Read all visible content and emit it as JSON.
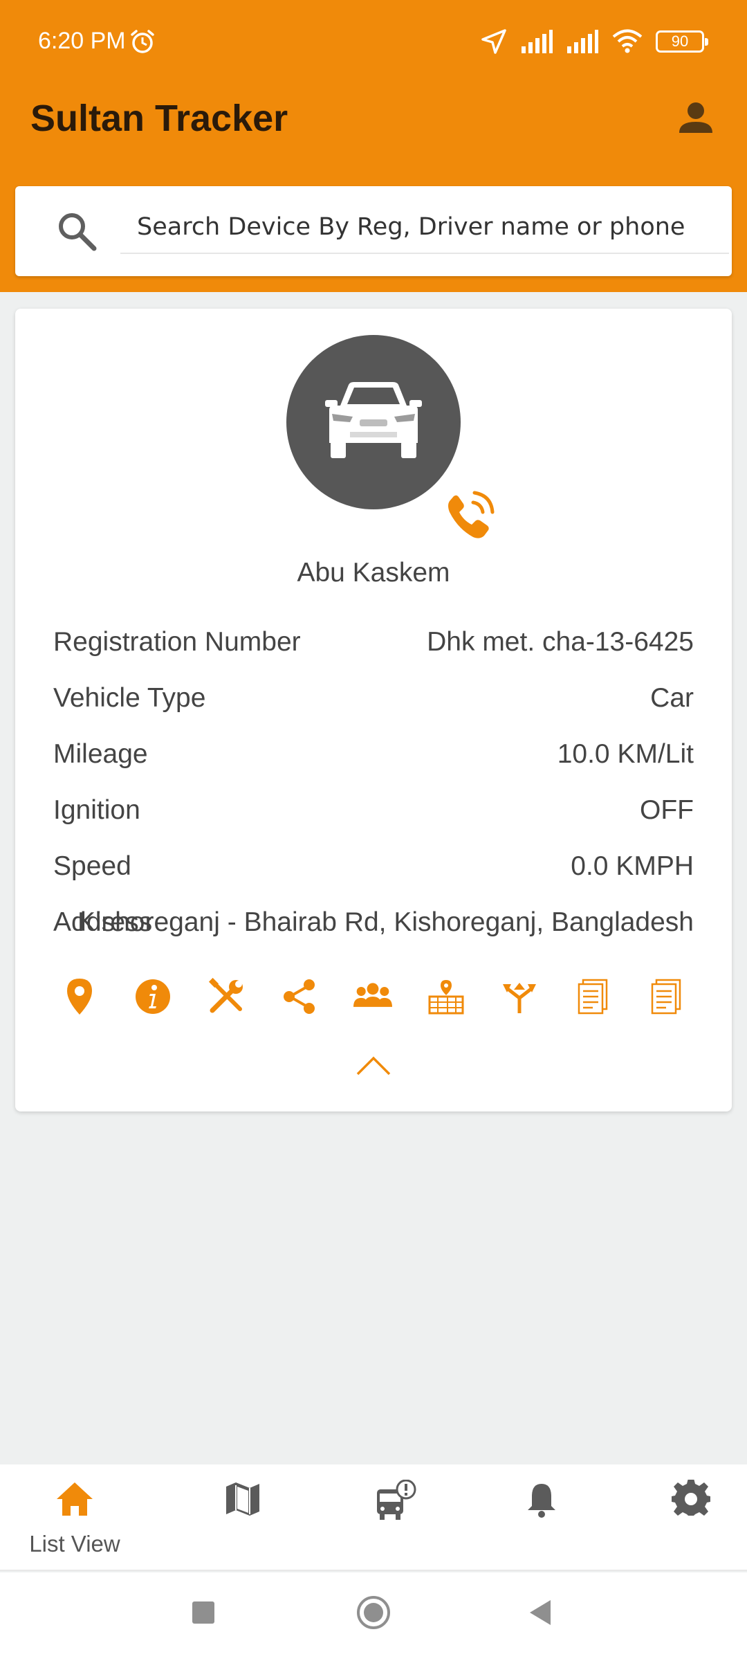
{
  "status_bar": {
    "time": "6:20 PM",
    "battery": "90"
  },
  "app": {
    "title": "Sultan Tracker"
  },
  "search": {
    "placeholder": "Search Device By Reg, Driver name or phone"
  },
  "vehicle": {
    "driver_name": "Abu Kaskem",
    "rows": [
      {
        "label": "Registration Number",
        "value": "Dhk met. cha-13-6425"
      },
      {
        "label": "Vehicle Type",
        "value": "Car"
      },
      {
        "label": "Mileage",
        "value": "10.0 KM/Lit"
      },
      {
        "label": "Ignition",
        "value": "OFF"
      },
      {
        "label": "Speed",
        "value": "0.0 KMPH"
      },
      {
        "label": "Address",
        "value": "Kishoreganj - Bhairab Rd, Kishoreganj, Bangladesh"
      }
    ]
  },
  "actions": [
    "location-pin-icon",
    "info-icon",
    "tools-icon",
    "share-icon",
    "group-icon",
    "geofence-map-icon",
    "route-icon",
    "report-icon",
    "report-alt-icon"
  ],
  "bottom_nav": {
    "active_label": "List View"
  },
  "colors": {
    "accent": "#f08a0a",
    "avatar_bg": "#575757",
    "nav_icon": "#5b5b5b"
  }
}
